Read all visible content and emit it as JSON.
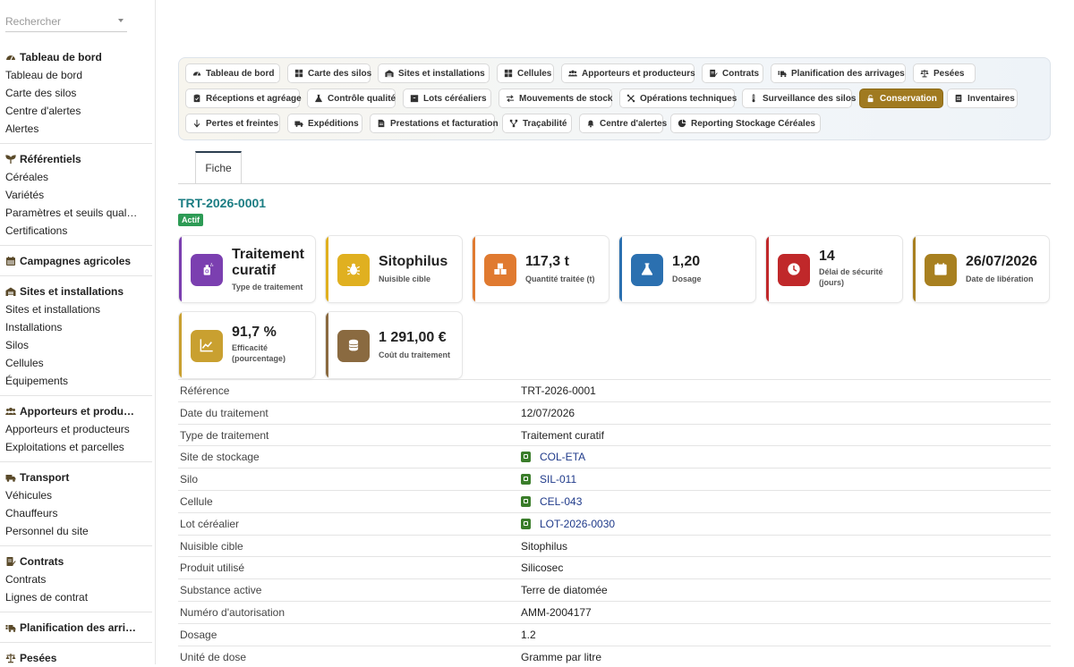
{
  "search": {
    "placeholder": "Rechercher"
  },
  "sidebar": {
    "sections": [
      {
        "title": "Tableau de bord",
        "icon": "gauge-icon",
        "items": [
          "Tableau de bord",
          "Carte des silos",
          "Centre d'alertes",
          "Alertes"
        ]
      },
      {
        "title": "Référentiels",
        "icon": "sprout-icon",
        "items": [
          "Céréales",
          "Variétés",
          "Paramètres et seuils qual…",
          "Certifications"
        ]
      },
      {
        "title": "Campagnes agricoles",
        "icon": "calendar-icon",
        "items": []
      },
      {
        "title": "Sites et installations",
        "icon": "warehouse-icon",
        "items": [
          "Sites et installations",
          "Installations",
          "Silos",
          "Cellules",
          "Équipements"
        ]
      },
      {
        "title": "Apporteurs et produ…",
        "icon": "users-icon",
        "items": [
          "Apporteurs et producteurs",
          "Exploitations et parcelles"
        ]
      },
      {
        "title": "Transport",
        "icon": "truck-icon",
        "items": [
          "Véhicules",
          "Chauffeurs",
          "Personnel du site"
        ]
      },
      {
        "title": "Contrats",
        "icon": "contract-icon",
        "items": [
          "Contrats",
          "Lignes de contrat"
        ]
      },
      {
        "title": "Planification des arri…",
        "icon": "truck-loading-icon",
        "items": []
      },
      {
        "title": "Pesées",
        "icon": "scale-icon",
        "items": []
      }
    ]
  },
  "nav": {
    "rows": [
      [
        "Tableau de bord",
        "Carte des silos",
        "Sites et installations",
        "Cellules",
        "Apporteurs et producteurs",
        "Contrats",
        "Planification des arrivages",
        "Pesées"
      ],
      [
        "Réceptions et agréage",
        "Contrôle qualité",
        "Lots céréaliers",
        "Mouvements de stock",
        "Opérations techniques",
        "Surveillance des silos",
        "Conservation",
        "Inventaires"
      ],
      [
        "Pertes et freintes",
        "Expéditions",
        "Prestations et facturation",
        "Traçabilité",
        "Centre d'alertes",
        "Reporting Stockage Céréales"
      ]
    ],
    "active": "Conservation"
  },
  "tab": {
    "label": "Fiche"
  },
  "record": {
    "title": "TRT-2026-0001",
    "status": "Actif"
  },
  "cards": [
    {
      "value": "Traitement curatif",
      "label": "Type de traitement",
      "color": "#7b3fb0",
      "icon": "spray-icon"
    },
    {
      "value": "Sitophilus",
      "label": "Nuisible cible",
      "color": "#e0b020",
      "icon": "bug-icon"
    },
    {
      "value": "117,3 t",
      "label": "Quantité traitée (t)",
      "color": "#e07a30",
      "icon": "boxes-icon"
    },
    {
      "value": "1,20",
      "label": "Dosage",
      "color": "#2b70b0",
      "icon": "flask-icon"
    },
    {
      "value": "14",
      "label": "Délai de sécurité (jours)",
      "color": "#c0282a",
      "icon": "clock-icon"
    },
    {
      "value": "26/07/2026",
      "label": "Date de libération",
      "color": "#a88020",
      "icon": "calendar-icon"
    },
    {
      "value": "91,7 %",
      "label": "Efficacité (pourcentage)",
      "color": "#c9a030",
      "icon": "chart-icon"
    },
    {
      "value": "1 291,00 €",
      "label": "Coût du traitement",
      "color": "#8a6a40",
      "icon": "coins-icon"
    }
  ],
  "details": [
    {
      "key": "Référence",
      "value": "TRT-2026-0001",
      "link": false
    },
    {
      "key": "Date du traitement",
      "value": "12/07/2026",
      "link": false
    },
    {
      "key": "Type de traitement",
      "value": "Traitement curatif",
      "link": false
    },
    {
      "key": "Site de stockage",
      "value": "COL-ETA",
      "link": true
    },
    {
      "key": "Silo",
      "value": "SIL-011",
      "link": true
    },
    {
      "key": "Cellule",
      "value": "CEL-043",
      "link": true
    },
    {
      "key": "Lot céréalier",
      "value": "LOT-2026-0030",
      "link": true
    },
    {
      "key": "Nuisible cible",
      "value": "Sitophilus",
      "link": false
    },
    {
      "key": "Produit utilisé",
      "value": "Silicosec",
      "link": false
    },
    {
      "key": "Substance active",
      "value": "Terre de diatomée",
      "link": false
    },
    {
      "key": "Numéro d'autorisation",
      "value": "AMM-2004177",
      "link": false
    },
    {
      "key": "Dosage",
      "value": "1.2",
      "link": false
    },
    {
      "key": "Unité de dose",
      "value": "Gramme par litre",
      "link": false
    }
  ]
}
